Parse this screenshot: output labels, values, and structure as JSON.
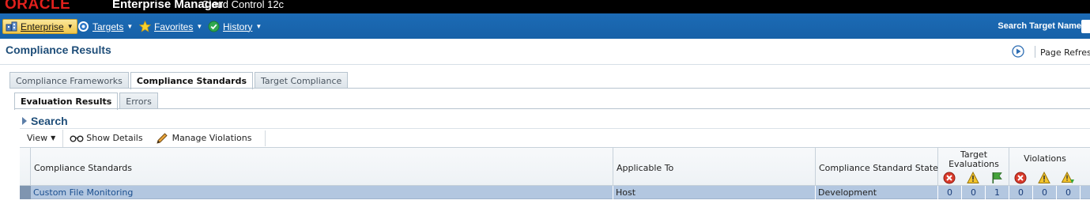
{
  "header": {
    "brand": "ORACLE",
    "product": "Enterprise Manager",
    "version": "Cloud Control 12c"
  },
  "menu": {
    "items": [
      {
        "label": "Enterprise",
        "icon": "enterprise-icon"
      },
      {
        "label": "Targets",
        "icon": "targets-icon"
      },
      {
        "label": "Favorites",
        "icon": "star-icon"
      },
      {
        "label": "History",
        "icon": "history-icon"
      }
    ],
    "search_label": "Search Target Name"
  },
  "page": {
    "title": "Compliance Results",
    "refresh_label": "Page Refresh"
  },
  "tabs": [
    {
      "label": "Compliance Frameworks"
    },
    {
      "label": "Compliance Standards"
    },
    {
      "label": "Target Compliance"
    }
  ],
  "subtabs": [
    {
      "label": "Evaluation Results"
    },
    {
      "label": "Errors"
    }
  ],
  "search": {
    "title": "Search"
  },
  "toolbar": {
    "view_label": "View",
    "show_details_label": "Show Details",
    "manage_violations_label": "Manage Violations"
  },
  "table": {
    "columns": {
      "standards": "Compliance Standards",
      "applicable_to": "Applicable To",
      "state": "Compliance Standard State",
      "target_evaluations": "Target Evaluations",
      "violations": "Violations"
    },
    "status_icons": [
      "critical-icon",
      "warning-icon",
      "compliant-flag-icon",
      "critical-icon",
      "warning-icon",
      "minor-warning-icon"
    ],
    "rows": [
      {
        "standard": "Custom File Monitoring",
        "applicable_to": "Host",
        "state": "Development",
        "eval_critical": "0",
        "eval_warning": "0",
        "eval_compliant": "1",
        "viol_critical": "0",
        "viol_warning": "0",
        "viol_minor": "0"
      }
    ]
  }
}
